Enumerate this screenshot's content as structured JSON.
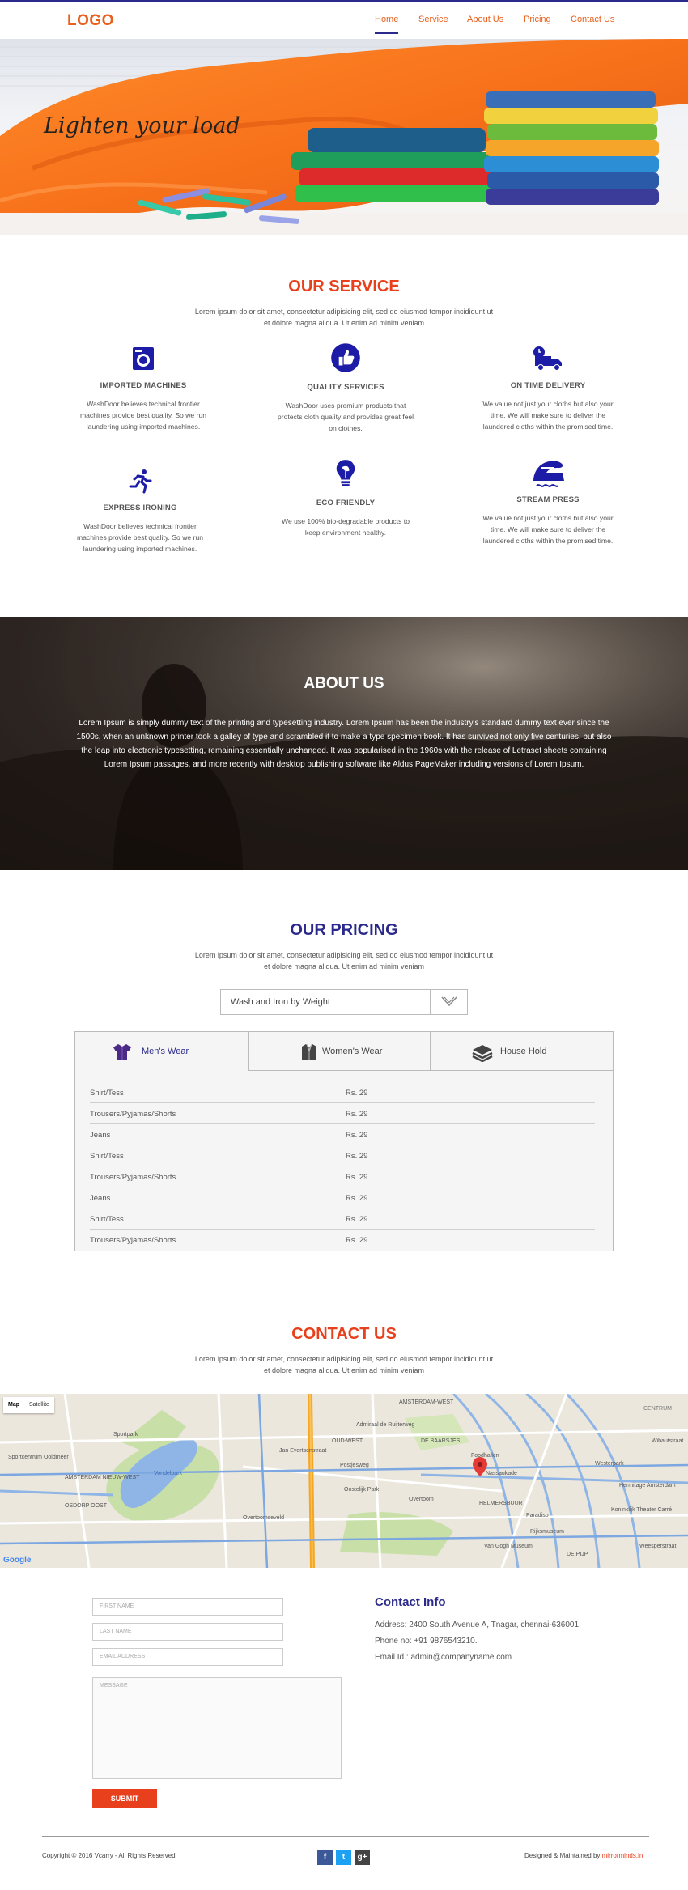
{
  "header": {
    "logo": "LOGO",
    "nav": [
      {
        "label": "Home",
        "active": true
      },
      {
        "label": "Service",
        "active": false
      },
      {
        "label": "About Us",
        "active": false
      },
      {
        "label": "Pricing",
        "active": false
      },
      {
        "label": "Contact Us",
        "active": false
      }
    ]
  },
  "hero": {
    "title": "Lighten your load"
  },
  "services": {
    "title": "OUR SERVICE",
    "subtitle": "Lorem ipsum dolor sit amet, consectetur adipisicing elit, sed do eiusmod tempor incididunt ut et dolore magna aliqua. Ut enim ad minim veniam",
    "items": [
      {
        "name": "IMPORTED MACHINES",
        "desc": "WashDoor believes technical frontier machines provide best quality. So we run laundering using imported machines.",
        "icon": "washing-machine-icon"
      },
      {
        "name": "QUALITY SERVICES",
        "desc": "WashDoor uses premium products that protects cloth quality and provides great feel on clothes.",
        "icon": "thumbs-up-icon"
      },
      {
        "name": "ON TIME DELIVERY",
        "desc": "We value not just your cloths but also your time. We will make sure to deliver the laundered cloths within the promised time.",
        "icon": "delivery-truck-icon"
      },
      {
        "name": "EXPRESS IRONING",
        "desc": "WashDoor believes technical frontier machines provide best quality. So we run laundering using imported machines.",
        "icon": "running-man-icon"
      },
      {
        "name": "ECO FRIENDLY",
        "desc": "We use 100% bio-degradable products to keep environment healthy.",
        "icon": "light-bulb-icon"
      },
      {
        "name": "STREAM PRESS",
        "desc": "We value not just your cloths but also your time. We will make sure to deliver the laundered cloths within the promised time.",
        "icon": "iron-icon"
      }
    ]
  },
  "about": {
    "title": "ABOUT US",
    "text": "Lorem Ipsum is simply dummy text of the printing and typesetting industry. Lorem Ipsum has been the industry's standard dummy text ever since the 1500s, when an unknown printer took a galley of type and scrambled it to make a type specimen book. It has survived not only five centuries, but also the leap into electronic typesetting, remaining essentially unchanged. It was popularised in the 1960s with the release of Letraset sheets containing Lorem Ipsum passages, and more recently with desktop publishing software like Aldus PageMaker including versions of Lorem Ipsum."
  },
  "pricing": {
    "title": "OUR PRICING",
    "subtitle": "Lorem ipsum dolor sit amet, consectetur adipisicing elit, sed do eiusmod tempor incididunt ut et dolore magna aliqua. Ut enim ad minim veniam",
    "select_value": "Wash and Iron by Weight",
    "tabs": [
      {
        "label": "Men's Wear",
        "active": true,
        "icon": "shirt-icon"
      },
      {
        "label": "Women's Wear",
        "active": false,
        "icon": "jacket-icon"
      },
      {
        "label": "House Hold",
        "active": false,
        "icon": "folded-clothes-icon"
      }
    ],
    "rows": [
      {
        "item": "Shirt/Tess",
        "price": "Rs. 29"
      },
      {
        "item": "Trousers/Pyjamas/Shorts",
        "price": "Rs. 29"
      },
      {
        "item": "Jeans",
        "price": "Rs. 29"
      },
      {
        "item": "Shirt/Tess",
        "price": "Rs. 29"
      },
      {
        "item": "Trousers/Pyjamas/Shorts",
        "price": "Rs. 29"
      },
      {
        "item": "Jeans",
        "price": "Rs. 29"
      },
      {
        "item": "Shirt/Tess",
        "price": "Rs. 29"
      },
      {
        "item": "Trousers/Pyjamas/Shorts",
        "price": "Rs. 29"
      }
    ]
  },
  "contact": {
    "title": "CONTACT US",
    "subtitle": "Lorem ipsum dolor sit amet, consectetur adipisicing elit, sed do eiusmod tempor incididunt ut et dolore magna aliqua. Ut enim ad minim veniam",
    "map": {
      "type_map": "Map",
      "type_satellite": "Satellite",
      "google": "Google",
      "labels": [
        "AMSTERDAM-WEST",
        "CENTRUM",
        "Sportpark",
        "Vondelpark",
        "Overtoomseveld",
        "Sportcentrum Ooldmeer",
        "AMSTERDAM NIEUW-WEST",
        "OSDORP OOST",
        "Oostelijk Park",
        "DE PIJP",
        "Rijksmuseum",
        "Van Gogh Museum",
        "HELMERSBUURT",
        "Paradiso",
        "Foodhallen",
        "DE BAARSJES",
        "Westerpark",
        "Koninklijk Theater Carré",
        "Hermitage Amsterdam",
        "OUD-WEST",
        "Jan Evertsenstraat",
        "Postjesweg",
        "Admiraal de Ruijterweg",
        "Overtoom",
        "Wibautstraat",
        "Weesperstraat",
        "Nassaukade"
      ]
    },
    "form": {
      "first_name": "FIRST NAME",
      "last_name": "LAST NAME",
      "email": "EMAIL ADDRESS",
      "message": "MESSAGE",
      "submit": "SUBMIT"
    },
    "info": {
      "title": "Contact Info",
      "address": "Address: 2400 South Avenue A, Tnagar, chennai-636001.",
      "phone": "Phone no: +91 9876543210.",
      "email": "Email Id : admin@companyname.com"
    }
  },
  "footer": {
    "copyright": "Copyright © 2016 Vcarry - All Rights Reserved",
    "credit_prefix": "Designed & Maintained by",
    "credit_link": "mirrorminds.in",
    "social": [
      {
        "icon": "facebook-icon",
        "glyph": "f",
        "color": "#3b5998"
      },
      {
        "icon": "twitter-icon",
        "glyph": "t",
        "color": "#1da1f2"
      },
      {
        "icon": "google-plus-icon",
        "glyph": "g+",
        "color": "#444444"
      }
    ]
  },
  "colors": {
    "accent": "#e8601c",
    "brand": "#2b2a8c"
  }
}
